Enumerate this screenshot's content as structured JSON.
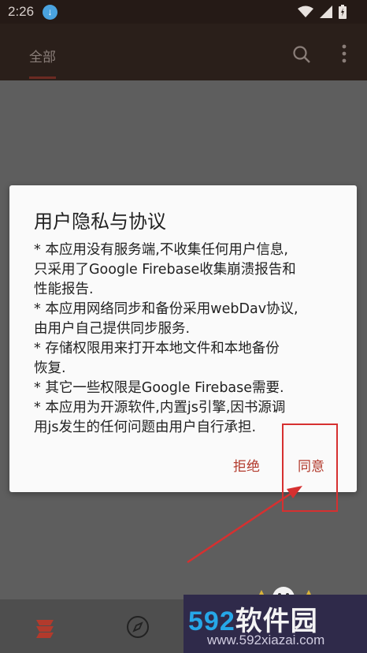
{
  "status_bar": {
    "time": "2:26"
  },
  "app_bar": {
    "tab_all": "全部"
  },
  "dialog": {
    "title": "用户隐私与协议",
    "body_lines": [
      "* 本应用没有服务端,不收集任何用户信息,",
      "只采用了Google Firebase收集崩溃报告和",
      "性能报告.",
      "* 本应用网络同步和备份采用webDav协议,",
      "由用户自己提供同步服务.",
      "* 存储权限用来打开本地文件和本地备份",
      "恢复.",
      "* 其它一些权限是Google Firebase需要.",
      "* 本应用为开源软件,内置js引擎,因书源调",
      "用js发生的任何问题由用户自行承担."
    ],
    "reject_label": "拒绝",
    "agree_label": "同意"
  },
  "watermark": {
    "logo_digits": "592",
    "logo_text": "软件园",
    "url": "www.592xiazai.com"
  },
  "colors": {
    "accent": "#b23a2c",
    "app_bar": "#2a1f1a",
    "annotation": "#d63030"
  },
  "icons": [
    "download-icon",
    "wifi-icon",
    "signal-icon",
    "battery-icon",
    "search-icon",
    "more-icon",
    "bookshelf-icon",
    "compass-icon"
  ]
}
